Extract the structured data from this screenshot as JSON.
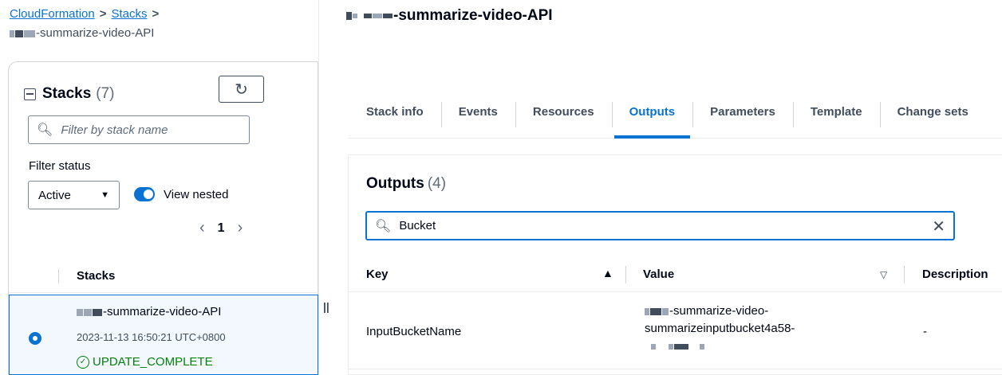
{
  "breadcrumb": {
    "items": [
      "CloudFormation",
      "Stacks"
    ],
    "current": "-summarize-video-API"
  },
  "stacks_panel": {
    "title": "Stacks",
    "count": "(7)",
    "filter_placeholder": "Filter by stack name",
    "filter_status_label": "Filter status",
    "status_selected": "Active",
    "view_nested_label": "View nested",
    "page": "1",
    "column_header": "Stacks",
    "selected_stack": {
      "name": "-summarize-video-API",
      "timestamp": "2023-11-13 16:50:21 UTC+0800",
      "status": "UPDATE_COMPLETE"
    }
  },
  "page_title": "-summarize-video-API",
  "tabs": [
    "Stack info",
    "Events",
    "Resources",
    "Outputs",
    "Parameters",
    "Template",
    "Change sets"
  ],
  "active_tab": "Outputs",
  "outputs": {
    "title": "Outputs",
    "count": "(4)",
    "search_value": "Bucket",
    "columns": [
      "Key",
      "Value",
      "Description"
    ],
    "rows": [
      {
        "key": "InputBucketName",
        "value_line1": "-summarize-video-",
        "value_line2": "summarizeinputbucket4a58-",
        "description": "-"
      }
    ]
  },
  "colors": {
    "accent": "#0972d3",
    "success": "#037f0c",
    "text": "#000716"
  }
}
